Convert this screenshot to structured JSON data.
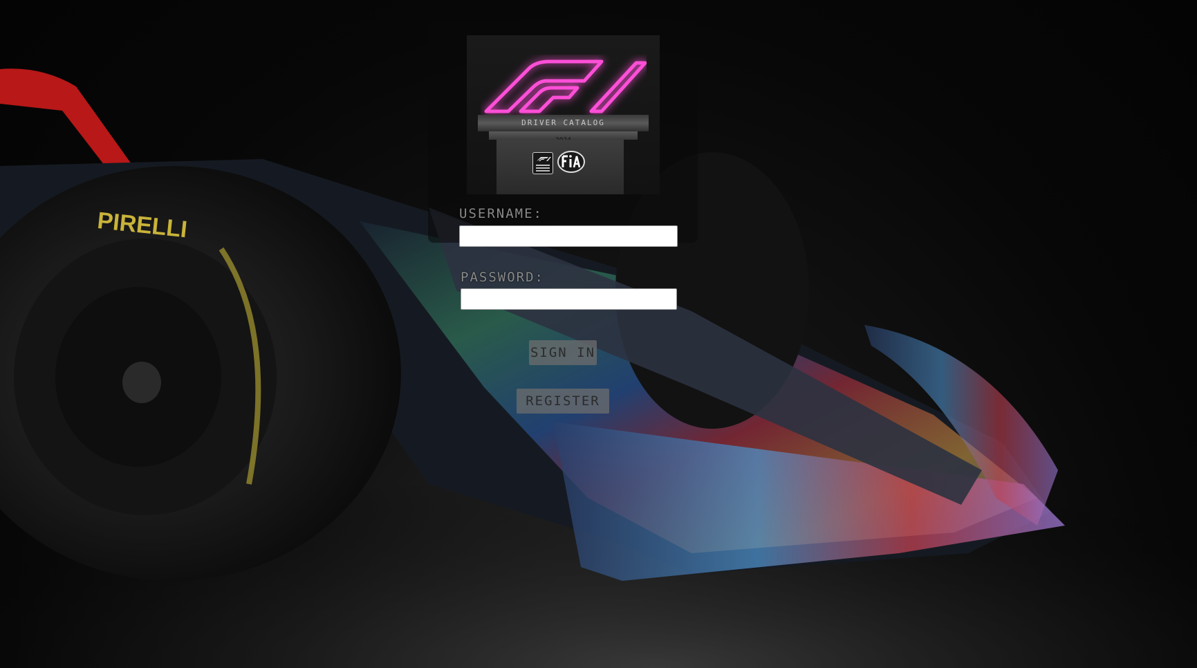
{
  "brand": {
    "logo_icon": "f1-neon-logo-icon",
    "catalog_title": "DRIVER CATALOG",
    "year": "2024",
    "badges": [
      "formula1-licensed-product-icon",
      "fia-icon"
    ]
  },
  "form": {
    "username_label": "USERNAME:",
    "username_value": "",
    "password_label": "PASSWORD:",
    "password_value": "",
    "signin_label": "SIGN IN",
    "register_label": "REGISTER"
  },
  "colors": {
    "neon_pink": "#ff4fd8",
    "background": "#060606",
    "button": "#6e6e6e"
  }
}
